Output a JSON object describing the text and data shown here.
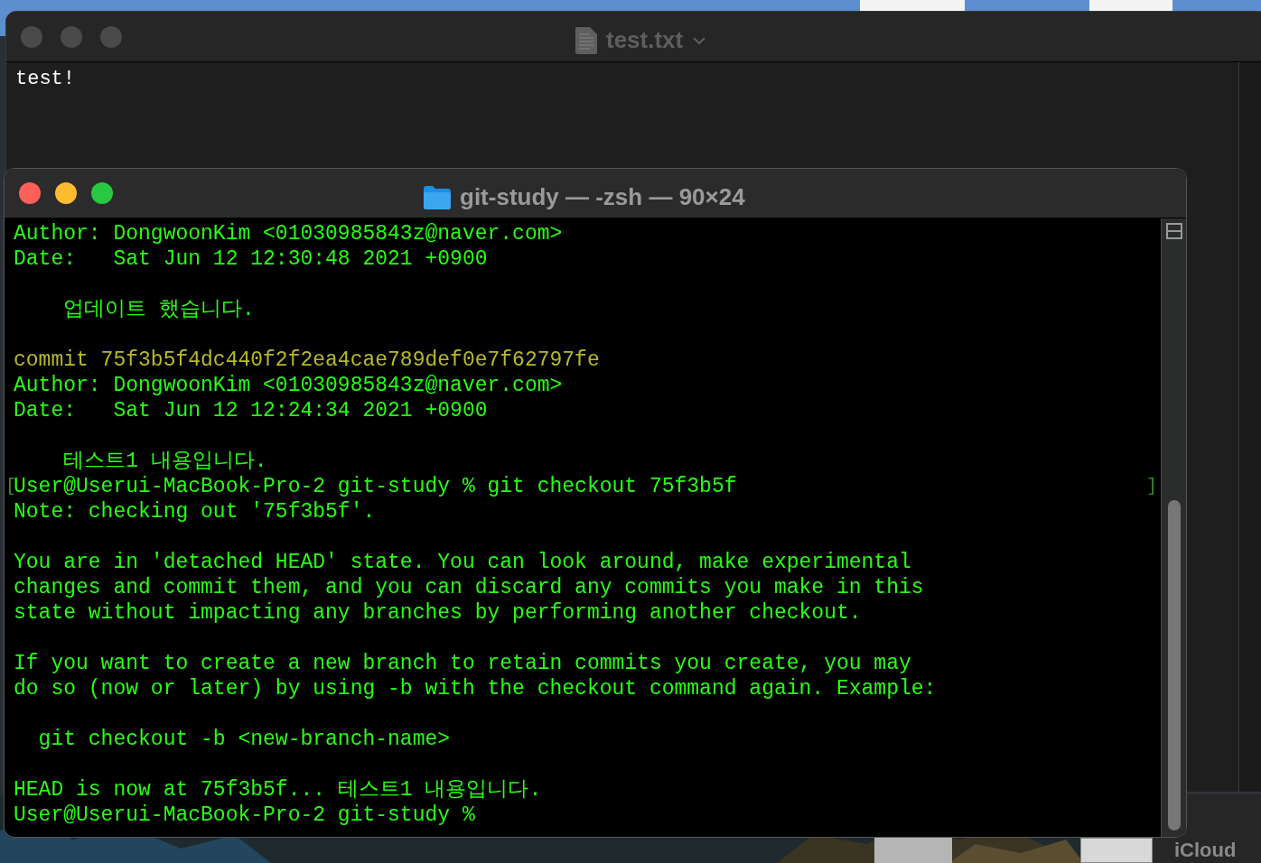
{
  "desktop": {
    "labels": [
      "iCloud"
    ]
  },
  "editor_window": {
    "title": "test.txt",
    "content": "test!"
  },
  "terminal_window": {
    "title": "git-study — -zsh — 90×24",
    "lines": [
      {
        "kind": "output",
        "text": "Author: DongwoonKim <01030985843z@naver.com>"
      },
      {
        "kind": "output",
        "text": "Date:   Sat Jun 12 12:30:48 2021 +0900"
      },
      {
        "kind": "blank"
      },
      {
        "kind": "output",
        "text": "    업데이트 했습니다."
      },
      {
        "kind": "blank"
      },
      {
        "kind": "commit",
        "text": "commit 75f3b5f4dc440f2f2ea4cae789def0e7f62797fe"
      },
      {
        "kind": "output",
        "text": "Author: DongwoonKim <01030985843z@naver.com>"
      },
      {
        "kind": "output",
        "text": "Date:   Sat Jun 12 12:24:34 2021 +0900"
      },
      {
        "kind": "blank"
      },
      {
        "kind": "output",
        "text": "    테스트1 내용입니다."
      },
      {
        "kind": "prompt",
        "open_mark": "[",
        "text": "User@Userui-MacBook-Pro-2 git-study % git checkout 75f3b5f",
        "close_mark": "]"
      },
      {
        "kind": "output",
        "text": "Note: checking out '75f3b5f'."
      },
      {
        "kind": "blank"
      },
      {
        "kind": "output",
        "text": "You are in 'detached HEAD' state. You can look around, make experimental"
      },
      {
        "kind": "output",
        "text": "changes and commit them, and you can discard any commits you make in this"
      },
      {
        "kind": "output",
        "text": "state without impacting any branches by performing another checkout."
      },
      {
        "kind": "blank"
      },
      {
        "kind": "output",
        "text": "If you want to create a new branch to retain commits you create, you may"
      },
      {
        "kind": "output",
        "text": "do so (now or later) by using -b with the checkout command again. Example:"
      },
      {
        "kind": "blank"
      },
      {
        "kind": "output",
        "text": "  git checkout -b <new-branch-name>"
      },
      {
        "kind": "blank"
      },
      {
        "kind": "output",
        "text": "HEAD is now at 75f3b5f... 테스트1 내용입니다."
      },
      {
        "kind": "output",
        "text": "User@Userui-MacBook-Pro-2 git-study %"
      }
    ]
  }
}
